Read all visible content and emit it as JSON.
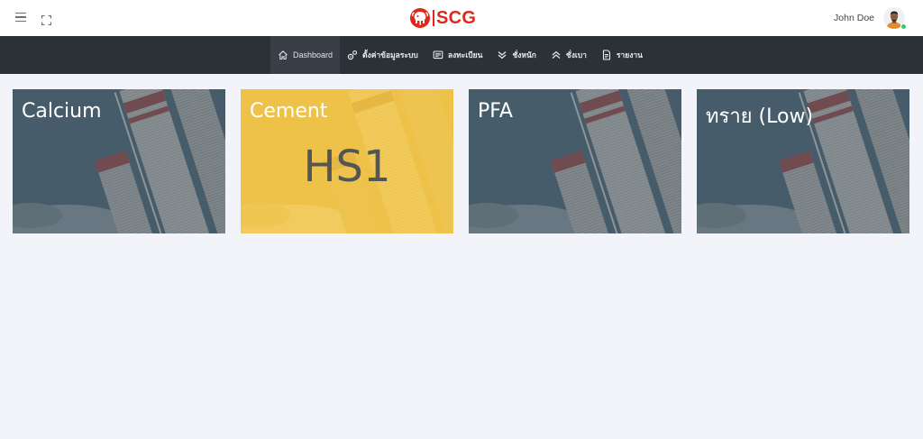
{
  "header": {
    "menu_icon": "hamburger-icon",
    "fullscreen_icon": "fullscreen-icon",
    "brand": "SCG",
    "brand_color": "#e1261c",
    "user_name": "John Doe",
    "status_color": "#2ecc71"
  },
  "nav": {
    "items": [
      {
        "label": "Dashboard",
        "icon": "home-icon",
        "active": true
      },
      {
        "label": "ตั้งค่าข้อมูลระบบ",
        "icon": "settings-icon"
      },
      {
        "label": "ลงทะเบียน",
        "icon": "register-icon"
      },
      {
        "label": "ชั่งหนัก",
        "icon": "double-chevron-down-icon"
      },
      {
        "label": "ชั่งเบา",
        "icon": "double-chevron-up-icon"
      },
      {
        "label": "รายงาน",
        "icon": "report-icon"
      }
    ]
  },
  "cards": [
    {
      "title": "Calcium",
      "value": "",
      "tint": "#3f5563"
    },
    {
      "title": "Cement",
      "value": "HS1",
      "tint": "#f0c53e"
    },
    {
      "title": "PFA",
      "value": "",
      "tint": "#3f5563"
    },
    {
      "title": "ทราย (Low)",
      "value": "",
      "tint": "#3f5563"
    }
  ]
}
